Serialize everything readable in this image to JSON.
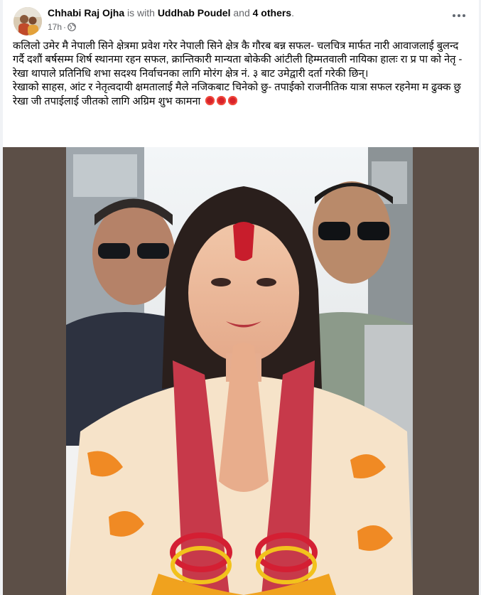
{
  "post": {
    "author": "Chhabi Raj Ojha",
    "with_text": "is with",
    "tagged_user": "Uddhab Poudel",
    "and_text": "and",
    "others": "4 others",
    "period": ".",
    "timestamp": "17h",
    "meta_separator": "·",
    "audience_icon": "globe-icon",
    "menu_icon": "more-horizontal-icon",
    "text_paragraphs": [
      "कलिलो उमेर मै नेपाली सिने क्षेत्रमा प्रवेश गरेर नेपाली सिने क्षेत्र कै गौरब बन्न सफल- चलचित्र मार्फत नारी आवाजलाई बुलन्द गर्दै दशौं बर्षसम्म शिर्ष स्थानमा रहन सफल, क्रान्तिकारी मान्यता बोकेकी आंटीली हिम्मतवाली नायिका हालः रा प्र पा को नेतृ - रेखा थापाले प्रतिनिधि शभा सदश्य निर्वाचनका लागि मोरंग क्षेत्र नं. ३ बाट उमेद्वारी दर्ता गरेकी छिन्।",
      "रेखाको साहस, आंट र नेतृत्वदायी क्षमतालाई मैले नजिकबाट चिनेको छु- तपाईको राजनीतिक यात्रा सफल रहनेमा म ढुक्क छु",
      "रेखा जी तपाईलाई जीतको लागि अग्रिम शुभ कामना"
    ],
    "emoji_count": 3,
    "emoji_name": "hibiscus",
    "photo": {
      "frame_color": "#5c4f47"
    }
  },
  "colors": {
    "name": "#050505",
    "secondary": "#65676b",
    "flower": "#d8232a"
  }
}
